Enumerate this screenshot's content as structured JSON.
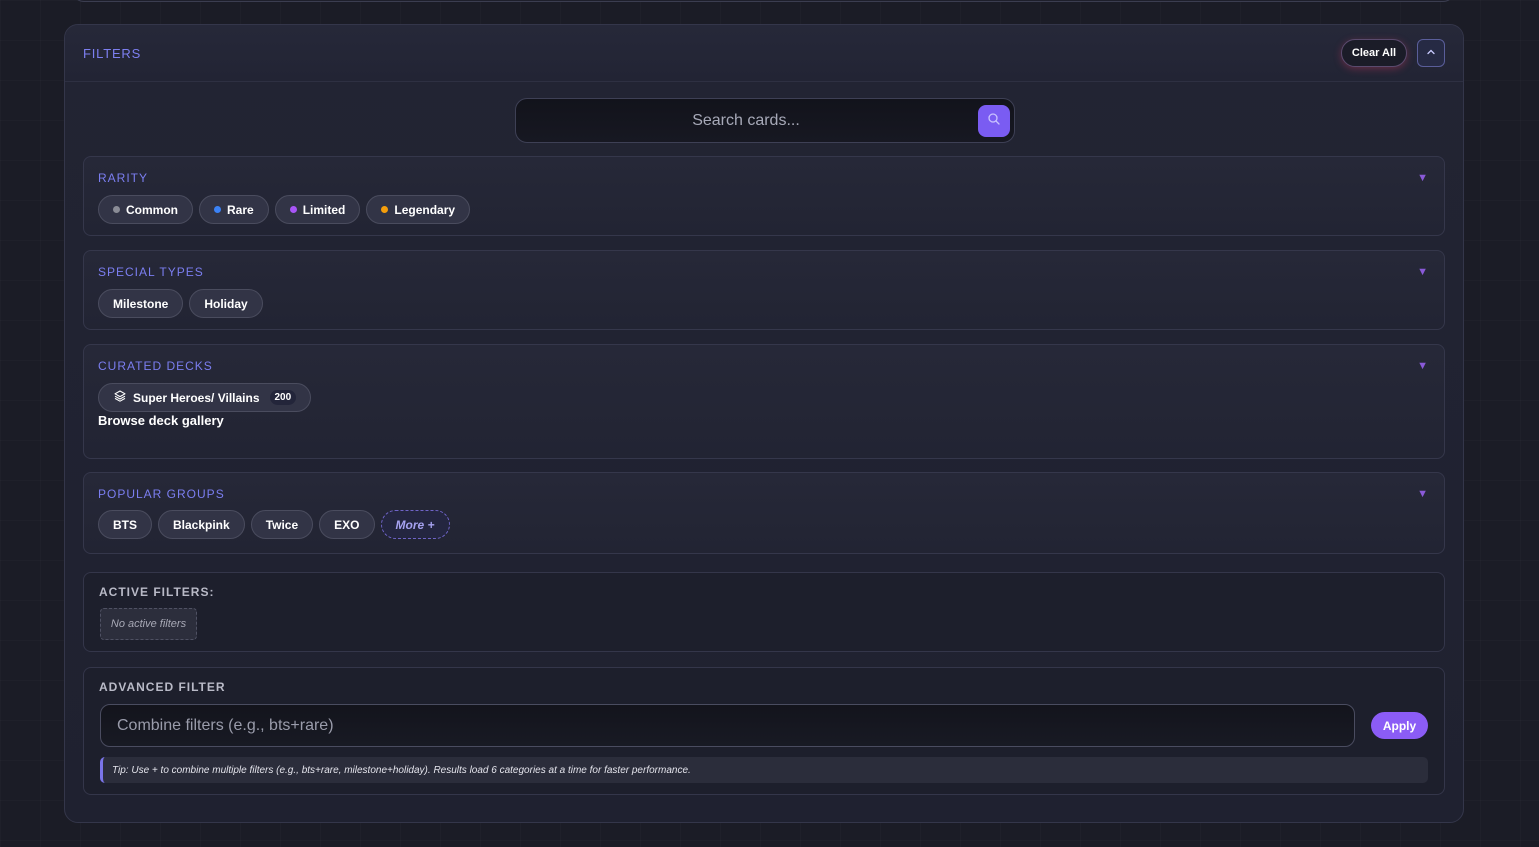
{
  "filters": {
    "title": "FILTERS",
    "clear_all_label": "Clear All",
    "collapse_icon": "chevron-up-icon"
  },
  "search": {
    "placeholder": "Search cards...",
    "button_icon": "search-icon"
  },
  "rarity": {
    "title": "RARITY",
    "items": [
      {
        "label": "Common",
        "color": "#8a8c96"
      },
      {
        "label": "Rare",
        "color": "#3b82f6"
      },
      {
        "label": "Limited",
        "color": "#a855f7"
      },
      {
        "label": "Legendary",
        "color": "#f59e0b"
      }
    ]
  },
  "special_types": {
    "title": "SPECIAL TYPES",
    "items": [
      {
        "label": "Milestone"
      },
      {
        "label": "Holiday"
      }
    ]
  },
  "curated_decks": {
    "title": "CURATED DECKS",
    "deck": {
      "label": "Super Heroes/ Villains",
      "count": "200",
      "icon": "layers-icon"
    },
    "browse_label": "Browse deck gallery"
  },
  "popular_groups": {
    "title": "POPULAR GROUPS",
    "items": [
      {
        "label": "BTS"
      },
      {
        "label": "Blackpink"
      },
      {
        "label": "Twice"
      },
      {
        "label": "EXO"
      }
    ],
    "more_label": "More +"
  },
  "active_filters": {
    "title": "ACTIVE FILTERS:",
    "empty_label": "No active filters"
  },
  "advanced_filter": {
    "title": "ADVANCED FILTER",
    "placeholder": "Combine filters (e.g., bts+rare)",
    "apply_label": "Apply",
    "tip": "Tip: Use + to combine multiple filters (e.g., bts+rare, milestone+holiday). Results load 6 categories at a time for faster performance."
  }
}
